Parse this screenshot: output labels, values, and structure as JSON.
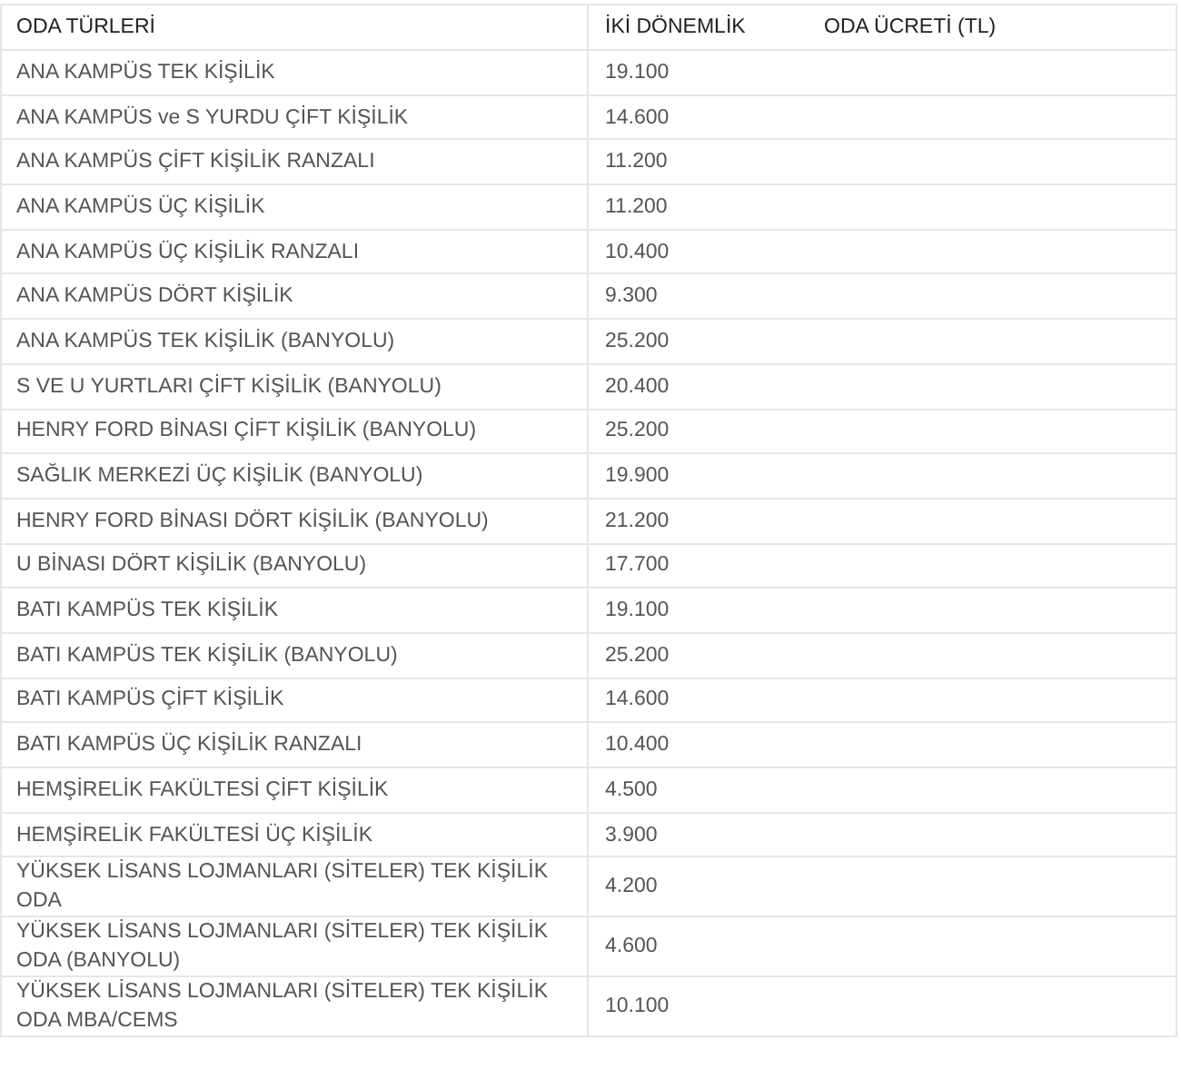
{
  "table": {
    "columns": [
      "ODA TÜRLERİ",
      "İKİ DÖNEMLİK",
      "ODA ÜCRETİ (TL)"
    ],
    "rows": [
      {
        "room": "ANA KAMPÜS TEK KİŞİLİK",
        "price": "19.100"
      },
      {
        "room": "ANA KAMPÜS ve S YURDU ÇİFT KİŞİLİK",
        "price": "14.600"
      },
      {
        "room": "ANA KAMPÜS ÇİFT KİŞİLİK RANZALI",
        "price": "11.200"
      },
      {
        "room": "ANA KAMPÜS ÜÇ KİŞİLİK",
        "price": "11.200"
      },
      {
        "room": "ANA KAMPÜS ÜÇ KİŞİLİK RANZALI",
        "price": "10.400"
      },
      {
        "room": "ANA KAMPÜS DÖRT KİŞİLİK",
        "price": "9.300"
      },
      {
        "room": "ANA KAMPÜS TEK KİŞİLİK (BANYOLU)",
        "price": "25.200"
      },
      {
        "room": "S VE U YURTLARI ÇİFT KİŞİLİK (BANYOLU)",
        "price": "20.400"
      },
      {
        "room": "HENRY FORD BİNASI ÇİFT KİŞİLİK (BANYOLU)",
        "price": "25.200"
      },
      {
        "room": "SAĞLIK MERKEZİ ÜÇ KİŞİLİK (BANYOLU)",
        "price": "19.900"
      },
      {
        "room": "HENRY FORD BİNASI DÖRT KİŞİLİK (BANYOLU)",
        "price": "21.200"
      },
      {
        "room": "U BİNASI DÖRT KİŞİLİK (BANYOLU)",
        "price": "17.700"
      },
      {
        "room": "BATI KAMPÜS TEK KİŞİLİK",
        "price": "19.100"
      },
      {
        "room": "BATI KAMPÜS TEK KİŞİLİK (BANYOLU)",
        "price": "25.200"
      },
      {
        "room": "BATI KAMPÜS ÇİFT KİŞİLİK",
        "price": "14.600"
      },
      {
        "room": "BATI KAMPÜS ÜÇ KİŞİLİK RANZALI",
        "price": "10.400"
      },
      {
        "room": "HEMŞİRELİK FAKÜLTESİ ÇİFT KİŞİLİK",
        "price": "4.500"
      },
      {
        "room": "HEMŞİRELİK FAKÜLTESİ ÜÇ KİŞİLİK",
        "price": "3.900"
      },
      {
        "room": "YÜKSEK LİSANS LOJMANLARI (SİTELER) TEK KİŞİLİK ODA",
        "price": "4.200"
      },
      {
        "room": "YÜKSEK LİSANS LOJMANLARI (SİTELER) TEK KİŞİLİK ODA (BANYOLU)",
        "price": "4.600"
      },
      {
        "room": "YÜKSEK LİSANS LOJMANLARI (SİTELER) TEK KİŞİLİK ODA MBA/CEMS",
        "price": "10.100"
      }
    ]
  }
}
